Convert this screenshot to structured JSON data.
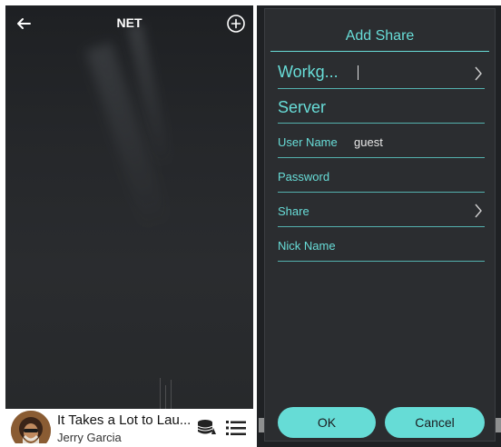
{
  "left": {
    "title": "NET",
    "player": {
      "song_title": "It Takes a Lot to Lau...",
      "artist": "Jerry Garcia"
    }
  },
  "dialog": {
    "title": "Add Share",
    "fields": {
      "workgroup_label": "Workg...",
      "server_label": "Server",
      "user_name_label": "User Name",
      "user_name_value": "guest",
      "password_label": "Password",
      "share_label": "Share",
      "nick_name_label": "Nick Name"
    },
    "ok_label": "OK",
    "cancel_label": "Cancel"
  },
  "colors": {
    "accent": "#66dcd6",
    "dialog_bg": "#2b2d30",
    "panel_bg": "#1f2124"
  },
  "icons": [
    "back-arrow-icon",
    "add-circle-icon",
    "storage-icon",
    "queue-list-icon",
    "chevron-right-icon"
  ]
}
